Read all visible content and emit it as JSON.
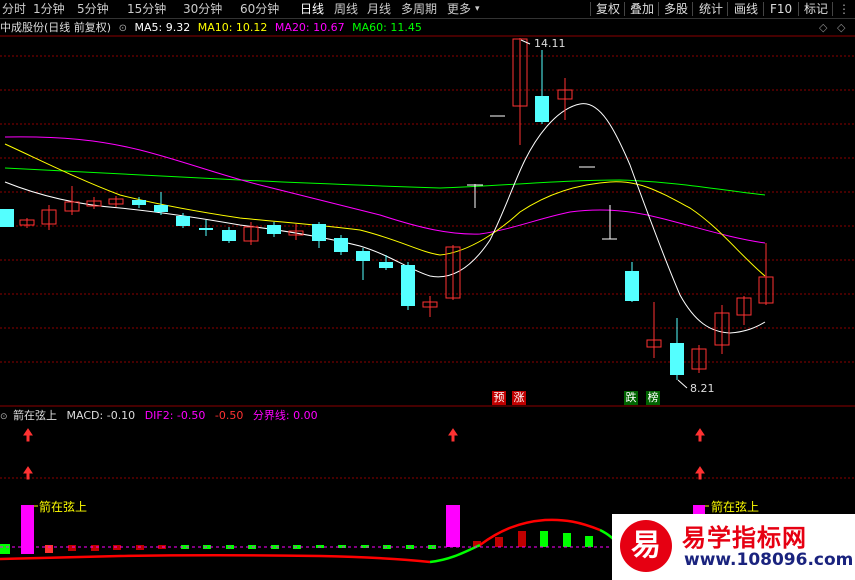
{
  "toolbar": {
    "periods": [
      "分时",
      "1分钟",
      "5分钟",
      "15分钟",
      "30分钟",
      "60分钟",
      "日线",
      "周线",
      "月线",
      "多周期",
      "更多"
    ],
    "active_period": "日线",
    "more_arrow": "▾",
    "actions": [
      "复权",
      "叠加",
      "多股",
      "统计",
      "画线",
      "F10",
      "标记"
    ],
    "dots_icon": "dots-icon"
  },
  "price_panel": {
    "title": "中成股份(日线 前复权)",
    "title_arrow": "⊙",
    "ma5": "MA5: 9.32",
    "ma10": "MA10: 10.12",
    "ma20": "MA20: 10.67",
    "ma60": "MA60: 11.45",
    "high_label": "14.11",
    "low_label": "8.21",
    "tag_pre": "预",
    "tag_zhang": "涨",
    "tag_die": "跌",
    "tag_bang": "榜",
    "colors": {
      "up": "#ff3232",
      "down": "#54ffff",
      "ma5": "#ffffff",
      "ma10": "#ffff00",
      "ma20": "#ff00ff",
      "ma60": "#00ff00"
    }
  },
  "macd_panel": {
    "title": "箭在弦上",
    "macd": "MACD: -0.10",
    "dif2": "DIF2: -0.50",
    "val": "-0.50",
    "fenjie": "分界线: 0.00",
    "signal_label_1": "箭在弦上",
    "signal_label_2": "箭在弦上"
  },
  "watermark": {
    "glyph": "易",
    "name": "易学指标网",
    "url": "www.108096.com"
  }
}
